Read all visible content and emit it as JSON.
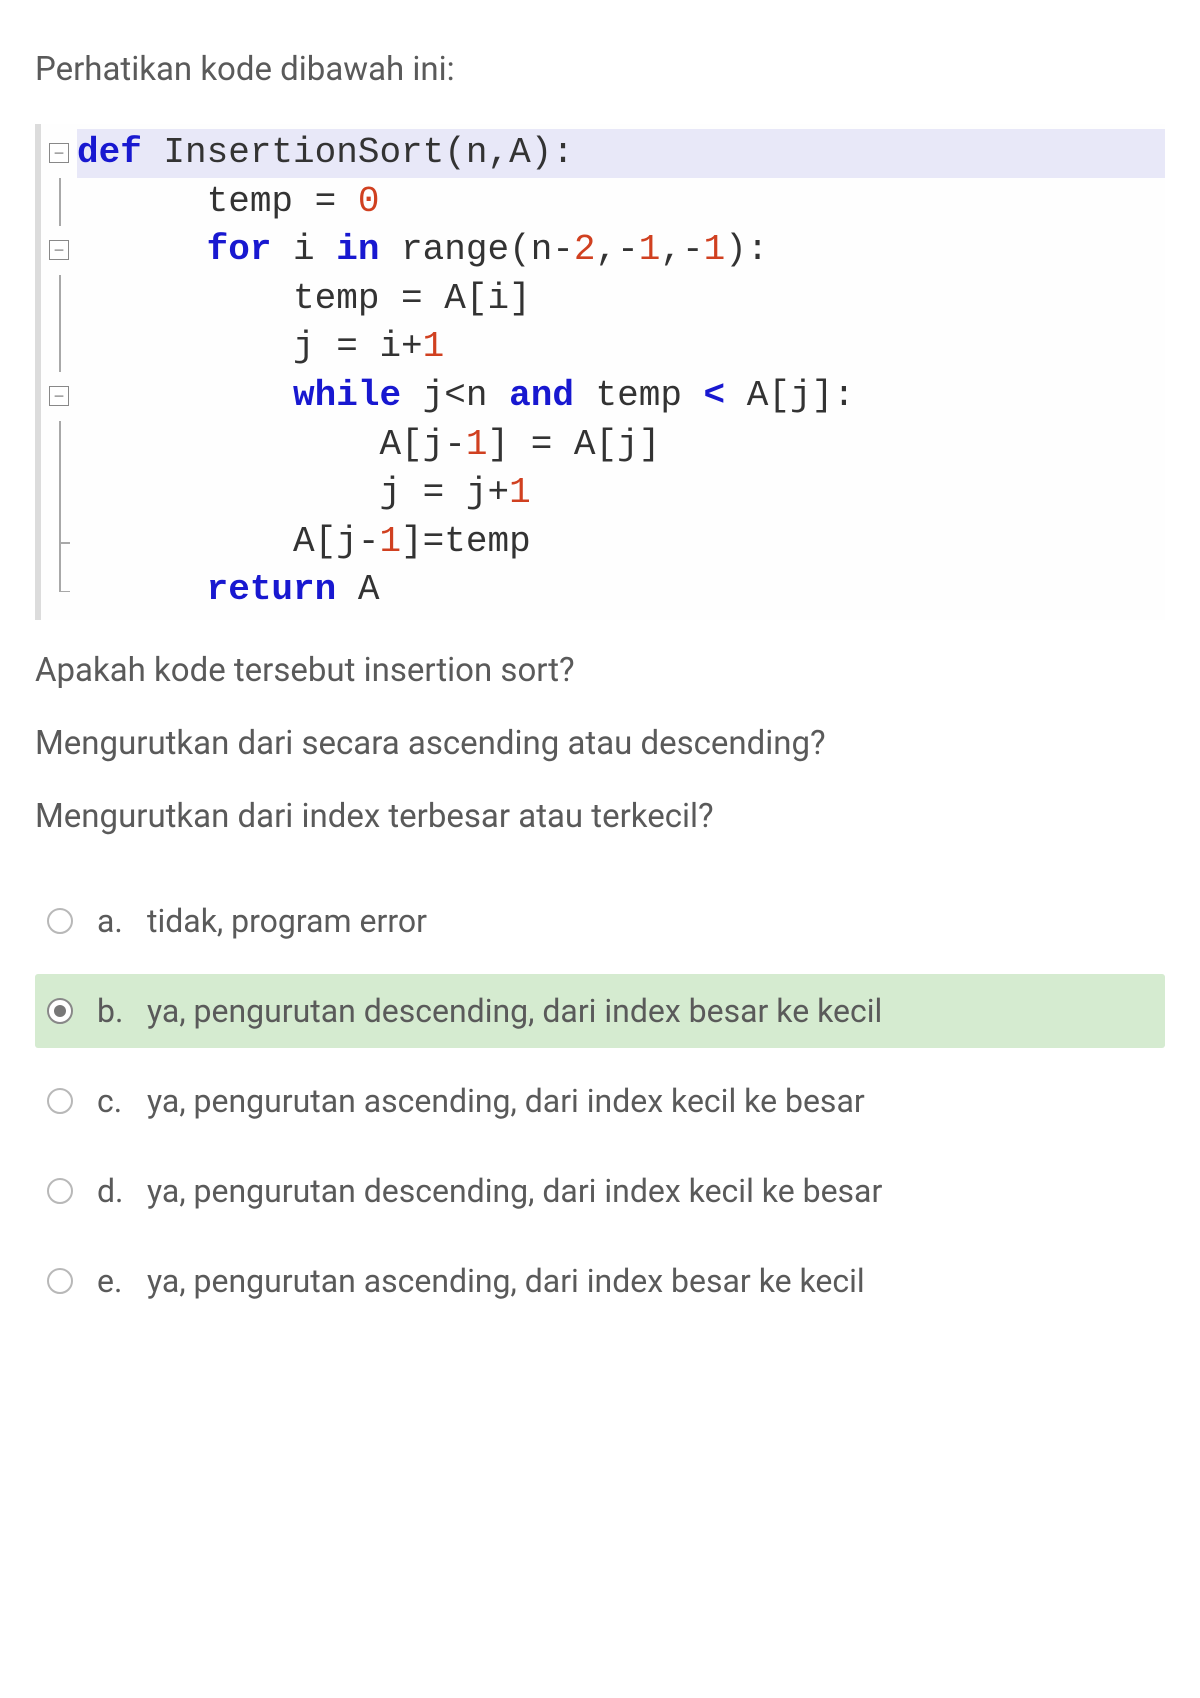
{
  "intro": "Perhatikan kode dibawah ini:",
  "code": {
    "l1_def": "def",
    "l1_func": " InsertionSort",
    "l1_rest": "(n,A):",
    "l2_pre": "      temp = ",
    "l2_num": "0",
    "l3_pre": "      ",
    "l3_for": "for",
    "l3_mid1": " i ",
    "l3_in": "in",
    "l3_mid2": " range(n-",
    "l3_n2": "2",
    "l3_c1": ",-",
    "l3_n1a": "1",
    "l3_c2": ",-",
    "l3_n1b": "1",
    "l3_end": "):",
    "l4": "          temp = A[i]",
    "l5_pre": "          j = i+",
    "l5_num": "1",
    "l6_pre": "          ",
    "l6_while": "while",
    "l6_mid1": " j<n ",
    "l6_and": "and",
    "l6_mid2": " temp ",
    "l6_lt": "<",
    "l6_end": " A[j]:",
    "l7_pre": "              A[j-",
    "l7_num": "1",
    "l7_end": "] = A[j]",
    "l8_pre": "              j = j+",
    "l8_num": "1",
    "l9_pre": "          A[j-",
    "l9_num": "1",
    "l9_end": "]=temp",
    "l10_pre": "      ",
    "l10_ret": "return",
    "l10_end": " A"
  },
  "q1": "Apakah kode tersebut insertion sort?",
  "q2": "Mengurutkan dari secara ascending atau descending?",
  "q3": "Mengurutkan dari index terbesar atau terkecil?",
  "options": {
    "a": {
      "letter": "a.",
      "text": "tidak, program error"
    },
    "b": {
      "letter": "b.",
      "text": "ya, pengurutan descending, dari index besar ke kecil"
    },
    "c": {
      "letter": "c.",
      "text": "ya, pengurutan ascending, dari index kecil ke besar"
    },
    "d": {
      "letter": "d.",
      "text": "ya, pengurutan descending, dari index kecil ke besar"
    },
    "e": {
      "letter": "e.",
      "text": "ya, pengurutan ascending, dari index besar ke kecil"
    }
  },
  "selected": "b"
}
